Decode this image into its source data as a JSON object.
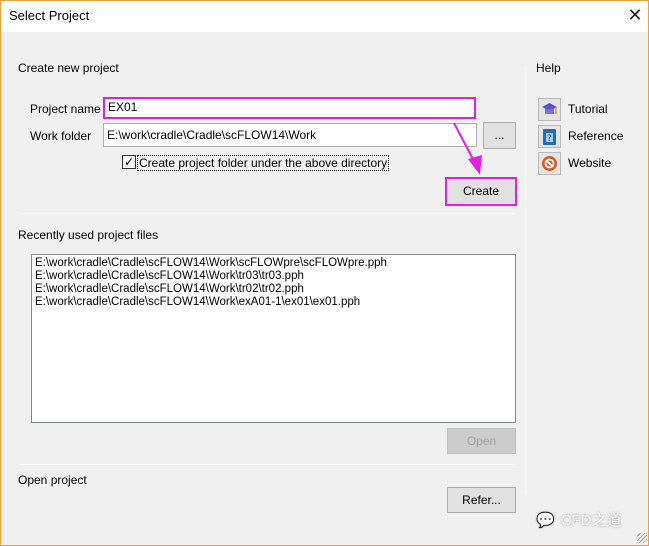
{
  "window": {
    "title": "Select Project"
  },
  "create": {
    "section": "Create new project",
    "project_name_label": "Project name",
    "project_name_value": "EX01",
    "work_folder_label": "Work folder",
    "work_folder_value": "E:\\work\\cradle\\Cradle\\scFLOW14\\Work",
    "browse_label": "...",
    "checkbox_label": "Create project folder under the above directory",
    "checkbox_checked": true,
    "create_label": "Create"
  },
  "recent": {
    "section": "Recently used project files",
    "files": [
      "E:\\work\\cradle\\Cradle\\scFLOW14\\Work\\scFLOWpre\\scFLOWpre.pph",
      "E:\\work\\cradle\\Cradle\\scFLOW14\\Work\\tr03\\tr03.pph",
      "E:\\work\\cradle\\Cradle\\scFLOW14\\Work\\tr02\\tr02.pph",
      "E:\\work\\cradle\\Cradle\\scFLOW14\\Work\\exA01-1\\ex01\\ex01.pph"
    ],
    "open_label": "Open"
  },
  "open": {
    "section": "Open project",
    "refer_label": "Refer..."
  },
  "help": {
    "section": "Help",
    "items": [
      {
        "label": "Tutorial",
        "icon": "graduation-cap-icon"
      },
      {
        "label": "Reference",
        "icon": "help-book-icon"
      },
      {
        "label": "Website",
        "icon": "web-icon"
      }
    ]
  },
  "watermark": "CFD之道",
  "highlight_color": "#e020e0"
}
